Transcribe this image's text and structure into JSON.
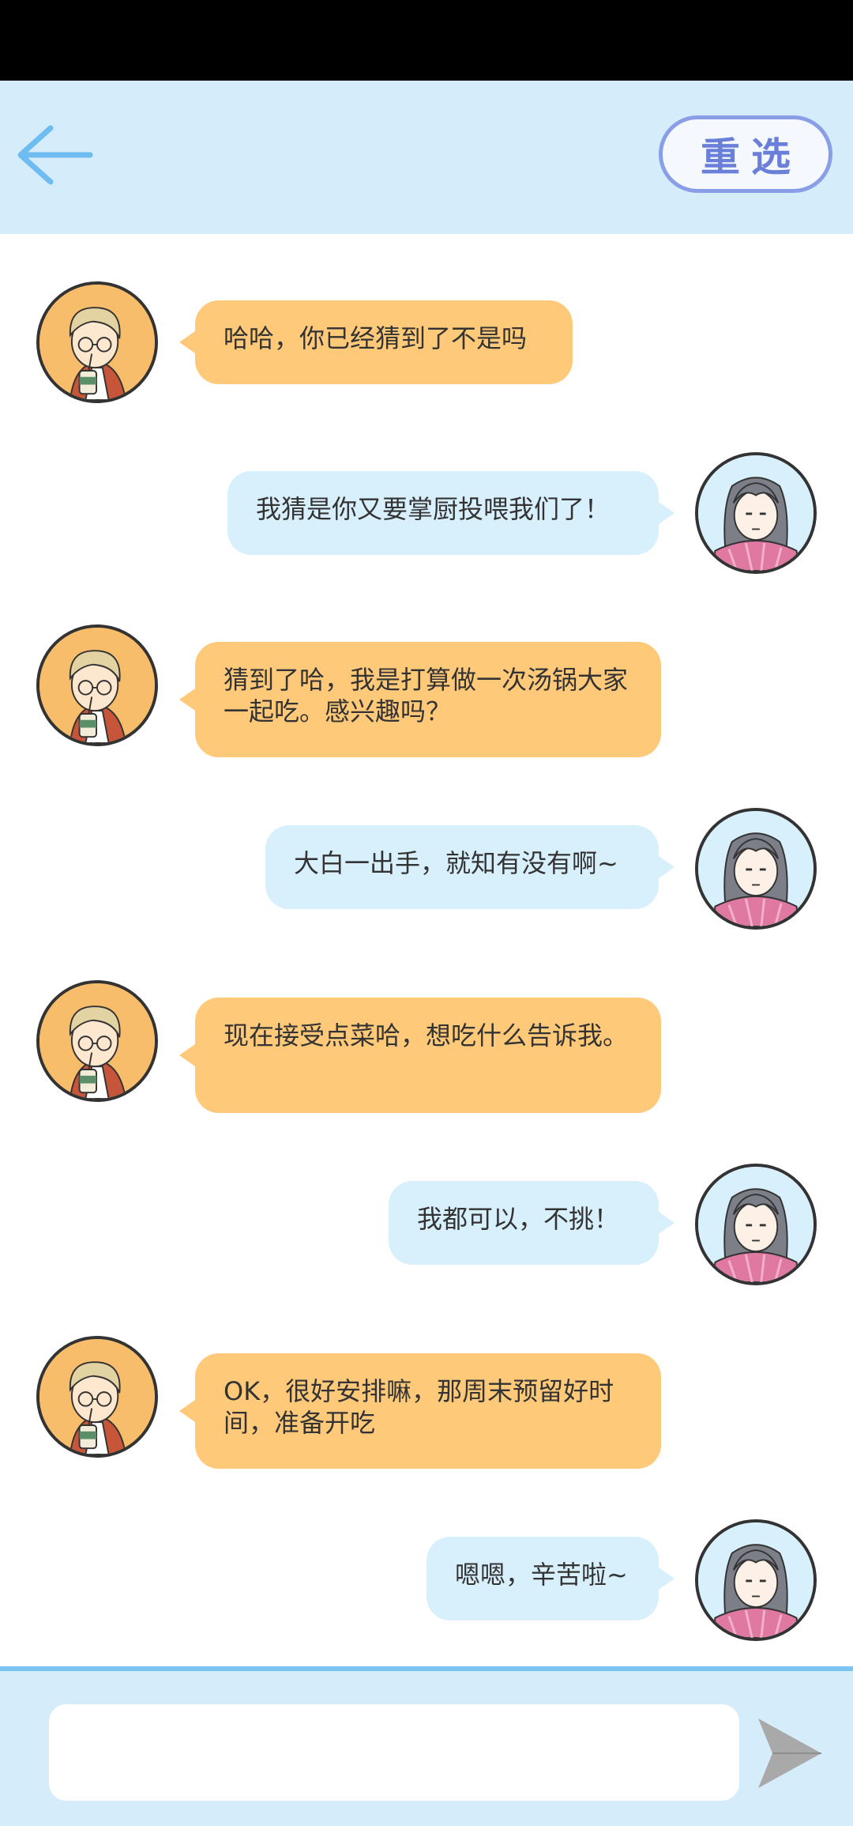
{
  "header": {
    "reset_label": "重选",
    "back_icon": "arrow-left-icon",
    "accent_color": "#7cc4f4"
  },
  "messages": [
    {
      "side": "left",
      "avatar": "boy-avatar",
      "text": "哈哈，你已经猜到了不是吗"
    },
    {
      "side": "right",
      "avatar": "girl-avatar",
      "text": "我猜是你又要掌厨投喂我们了！"
    },
    {
      "side": "left",
      "avatar": "boy-avatar",
      "text": "猜到了哈，我是打算做一次汤锅大家一起吃。感兴趣吗？"
    },
    {
      "side": "right",
      "avatar": "girl-avatar",
      "text": "大白一出手，就知有没有啊~"
    },
    {
      "side": "left",
      "avatar": "boy-avatar",
      "text": "现在接受点菜哈，想吃什么告诉我。"
    },
    {
      "side": "right",
      "avatar": "girl-avatar",
      "text": "我都可以，不挑！"
    },
    {
      "side": "left",
      "avatar": "boy-avatar",
      "text": "OK，很好安排嘛，那周末预留好时间，准备开吃"
    },
    {
      "side": "right",
      "avatar": "girl-avatar",
      "text": "嗯嗯，辛苦啦~"
    }
  ],
  "footer": {
    "input_value": "",
    "input_placeholder": "",
    "send_icon": "send-icon"
  },
  "colors": {
    "header_bg": "#d5ecfb",
    "left_bubble": "#ffc97a",
    "right_bubble": "#d8effc",
    "send_icon": "#a9a9a9"
  }
}
